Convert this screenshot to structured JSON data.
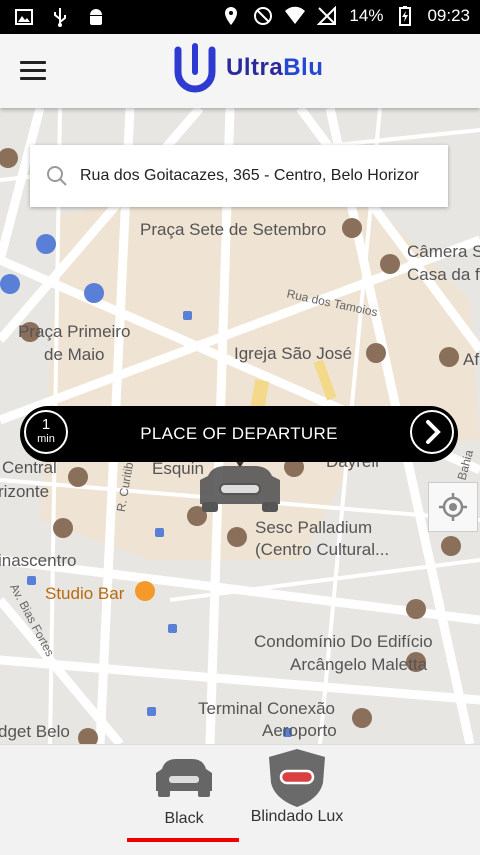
{
  "status_bar": {
    "battery": "14%",
    "time": "09:23"
  },
  "app": {
    "brand_a": "Ultra",
    "brand_b": "Blu"
  },
  "search": {
    "address": "Rua dos Goitacazes, 365 - Centro, Belo Horizor"
  },
  "departure": {
    "eta_value": "1",
    "eta_unit": "min",
    "title": "PLACE OF DEPARTURE"
  },
  "map_labels": {
    "praca_sete": "Praça Sete de Setembro",
    "camara": "Câmera S",
    "casa_da": "Casa da f",
    "rua_tamoios": "Rua dos Tamoios",
    "praca_primeiro": "Praça Primeiro",
    "de_maio": "de Maio",
    "igreja": "Igreja São José",
    "af": "Af",
    "central": "Central",
    "rizonte": "rizonte",
    "esquina": "Esquin",
    "dayrell": "Dayrell",
    "sesc1": "Sesc Palladium",
    "sesc2": "(Centro Cultural...",
    "inascentro": "inascentro",
    "studio_bar": "Studio Bar",
    "condominio1": "Condomínio Do Edifício",
    "condominio2": "Arcângelo Maletta",
    "terminal1": "Terminal Conexão",
    "terminal2": "Aeroporto",
    "dget_belo": "dget Belo",
    "r_curitiba": "R. Curitib",
    "av_bias": "Av. Bias Fortes",
    "bahia": "Bahia"
  },
  "vehicle_options": [
    {
      "label": "Black"
    },
    {
      "label": "Blindado Lux"
    }
  ]
}
